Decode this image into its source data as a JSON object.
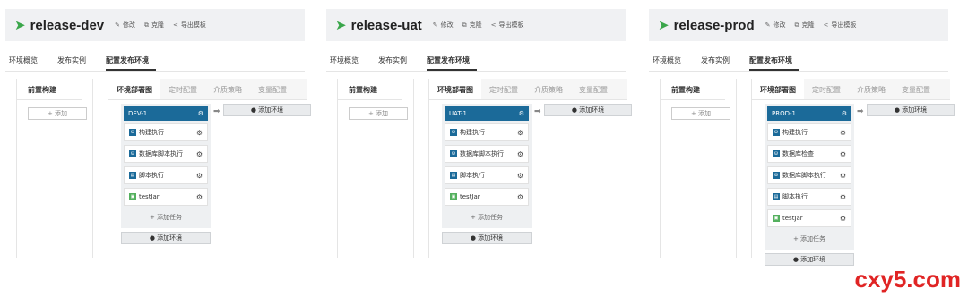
{
  "panels": [
    {
      "title": "release-dev",
      "actions": {
        "edit": "修改",
        "clone": "克隆",
        "export": "导出模板"
      },
      "tabs": [
        "环境概览",
        "发布实例",
        "配置发布环境"
      ],
      "left_head": "前置构建",
      "add_label": "+ 添加",
      "right_tabs": [
        "环境部署图",
        "定时配置",
        "介质策略",
        "变量配置"
      ],
      "stage_name": "DEV-1",
      "tasks": [
        "构建执行",
        "数据库脚本执行",
        "脚本执行",
        "testJar"
      ],
      "add_task": "+ 添加任务",
      "add_env": "添加环境"
    },
    {
      "title": "release-uat",
      "actions": {
        "edit": "修改",
        "clone": "克隆",
        "export": "导出模板"
      },
      "tabs": [
        "环境概览",
        "发布实例",
        "配置发布环境"
      ],
      "left_head": "前置构建",
      "add_label": "+ 添加",
      "right_tabs": [
        "环境部署图",
        "定时配置",
        "介质策略",
        "变量配置"
      ],
      "stage_name": "UAT-1",
      "tasks": [
        "构建执行",
        "数据库脚本执行",
        "脚本执行",
        "testJar"
      ],
      "add_task": "+ 添加任务",
      "add_env": "添加环境"
    },
    {
      "title": "release-prod",
      "actions": {
        "edit": "修改",
        "clone": "克隆",
        "export": "导出模板"
      },
      "tabs": [
        "环境概览",
        "发布实例",
        "配置发布环境"
      ],
      "left_head": "前置构建",
      "add_label": "+ 添加",
      "right_tabs": [
        "环境部署图",
        "定时配置",
        "介质策略",
        "变量配置"
      ],
      "stage_name": "PROD-1",
      "tasks": [
        "构建执行",
        "数据库检查",
        "数据库脚本执行",
        "脚本执行",
        "testJar"
      ],
      "add_task": "+ 添加任务",
      "add_env": "添加环境"
    }
  ],
  "icons": {
    "plane": "paper-plane-icon",
    "edit": "pencil-icon",
    "clone": "copy-icon",
    "export": "share-icon",
    "gear": "gear-icon",
    "add_env": "plus-circle-icon",
    "arrow": "arrow-right-icon"
  },
  "colors": {
    "stage_header": "#1b6a99",
    "accent_green": "#3aa64a",
    "watermark": "#e02424"
  },
  "watermark": "cxy5.com"
}
